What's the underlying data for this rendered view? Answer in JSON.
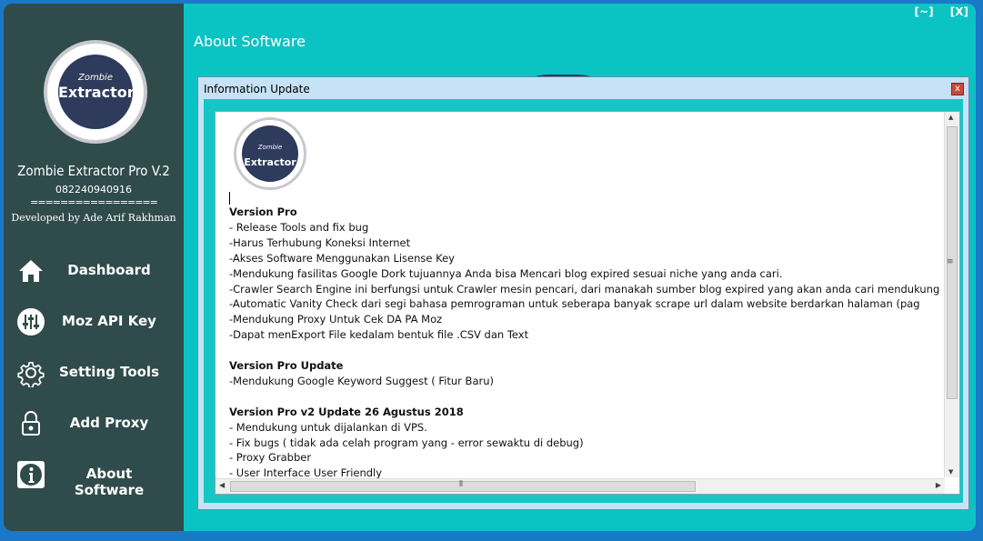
{
  "window": {
    "restore_btn": "[~]",
    "close_btn": "[X]"
  },
  "sidebar": {
    "logo": {
      "line1": "Zombie",
      "line2": "Extractor"
    },
    "app_name": "Zombie Extractor Pro V.2",
    "phone": "082240940916",
    "separator": "=================",
    "developer": "Developed by Ade Arif Rakhman",
    "nav": [
      {
        "label": "Dashboard",
        "icon": "home-icon"
      },
      {
        "label": "Moz API Key",
        "icon": "sliders-icon"
      },
      {
        "label": "Setting Tools",
        "icon": "gear-icon"
      },
      {
        "label": "Add Proxy",
        "icon": "lock-icon"
      },
      {
        "label": "About Software",
        "icon": "info-icon"
      }
    ]
  },
  "header": {
    "title": "About Software"
  },
  "dialog": {
    "title": "Information Update",
    "close": "x",
    "logo": {
      "line1": "Zombie",
      "line2": "Extractor"
    },
    "lines": [
      {
        "text": "Version Pro",
        "bold": true
      },
      {
        "text": "- Release Tools and fix bug",
        "bold": false
      },
      {
        "text": "-Harus Terhubung Koneksi Internet",
        "bold": false
      },
      {
        "text": "-Akses Software Menggunakan Lisense Key",
        "bold": false
      },
      {
        "text": "-Mendukung fasilitas Google Dork tujuannya Anda bisa Mencari blog expired sesuai niche yang anda cari.",
        "bold": false
      },
      {
        "text": "-Crawler Search Engine ini berfungsi untuk Crawler mesin pencari, dari manakah sumber blog expired yang akan anda cari mendukung",
        "bold": false
      },
      {
        "text": "-Automatic Vanity Check dari segi bahasa pemrograman untuk seberapa banyak scrape url dalam website berdarkan halaman (pag",
        "bold": false
      },
      {
        "text": "-Mendukung Proxy Untuk Cek DA PA Moz",
        "bold": false
      },
      {
        "text": "-Dapat menExport File kedalam bentuk file .CSV dan Text",
        "bold": false
      },
      {
        "text": "",
        "bold": false
      },
      {
        "text": "Version Pro Update",
        "bold": true
      },
      {
        "text": "-Mendukung Google Keyword Suggest ( Fitur Baru)",
        "bold": false
      },
      {
        "text": "",
        "bold": false
      },
      {
        "text": "Version Pro v2 Update 26 Agustus 2018",
        "bold": true
      },
      {
        "text": "- Mendukung untuk dijalankan di VPS.",
        "bold": false
      },
      {
        "text": "- Fix bugs ( tidak ada celah program yang - error sewaktu di debug)",
        "bold": false
      },
      {
        "text": "- Proxy Grabber",
        "bold": false
      },
      {
        "text": "- User Interface User Friendly",
        "bold": false
      }
    ]
  },
  "colors": {
    "sidebar_bg": "#304b4b",
    "main_bg": "#0cc3c3",
    "desktop_bg": "#1a78c9"
  }
}
